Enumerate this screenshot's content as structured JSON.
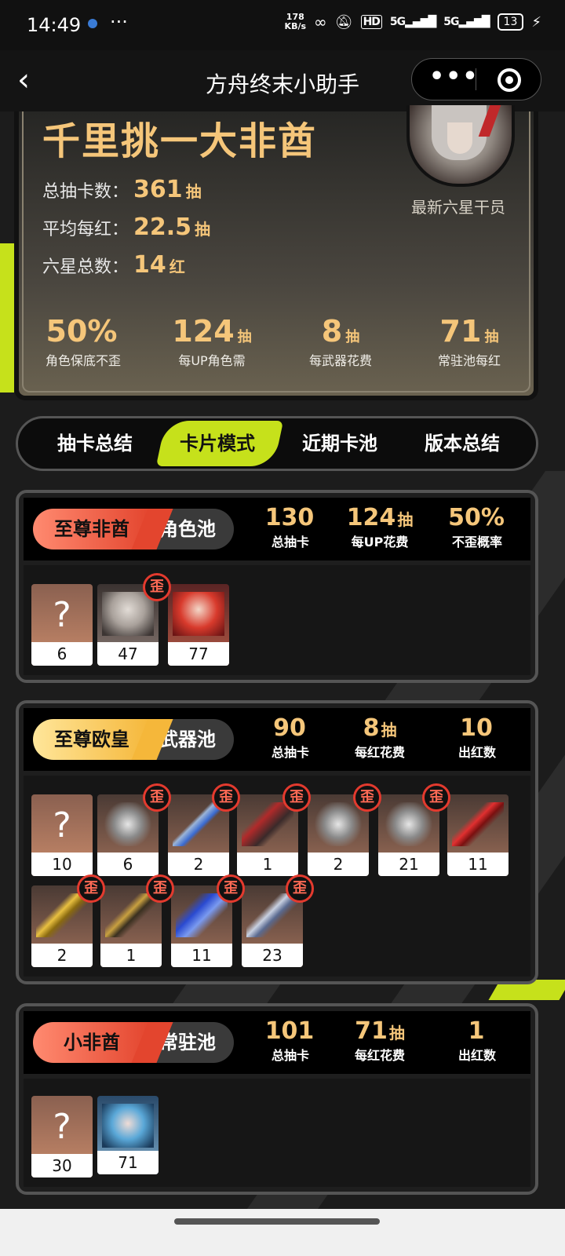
{
  "status": {
    "time": "14:49",
    "speed": "178",
    "speed_unit": "KB/s",
    "battery": "13",
    "net1": "5G",
    "net2": "5G",
    "hd": "HD"
  },
  "nav": {
    "title": "方舟终末小助手"
  },
  "summary": {
    "title": "千里挑一大非酋",
    "lines": [
      {
        "label": "总抽卡数：",
        "value": "361",
        "unit": "抽"
      },
      {
        "label": "平均每红：",
        "value": "22.5",
        "unit": "抽"
      },
      {
        "label": "六星总数：",
        "value": "14",
        "unit": "红"
      }
    ],
    "latest_label": "最新六星干员",
    "mini": [
      {
        "num": "50%",
        "unit": "",
        "label": "角色保底不歪"
      },
      {
        "num": "124",
        "unit": "抽",
        "label": "每UP角色需"
      },
      {
        "num": "8",
        "unit": "抽",
        "label": "每武器花费"
      },
      {
        "num": "71",
        "unit": "抽",
        "label": "常驻池每红"
      }
    ]
  },
  "tabs": [
    "抽卡总结",
    "卡片模式",
    "近期卡池",
    "版本总结"
  ],
  "wai_label": "歪",
  "unknown_mark": "?",
  "pools": [
    {
      "badge": "至尊非酋",
      "name": "角色池",
      "stats": [
        {
          "n": "130",
          "u": "",
          "l": "总抽卡"
        },
        {
          "n": "124",
          "u": "抽",
          "l": "每UP花费"
        },
        {
          "n": "50%",
          "u": "",
          "l": "不歪概率"
        }
      ],
      "items": [
        "6",
        "47",
        "77"
      ]
    },
    {
      "badge": "至尊欧皇",
      "name": "武器池",
      "stats": [
        {
          "n": "90",
          "u": "",
          "l": "总抽卡"
        },
        {
          "n": "8",
          "u": "抽",
          "l": "每红花费"
        },
        {
          "n": "10",
          "u": "",
          "l": "出红数"
        }
      ],
      "items": [
        "10",
        "6",
        "2",
        "1",
        "2",
        "21",
        "11",
        "2",
        "1",
        "11",
        "23"
      ]
    },
    {
      "badge": "小非酋",
      "name": "常驻池",
      "stats": [
        {
          "n": "101",
          "u": "",
          "l": "总抽卡"
        },
        {
          "n": "71",
          "u": "抽",
          "l": "每红花费"
        },
        {
          "n": "1",
          "u": "",
          "l": "出红数"
        }
      ],
      "items": [
        "30",
        "71"
      ]
    }
  ],
  "colors": {
    "accent": "#c6e11b",
    "gold": "#f5c67a",
    "wai_ring": "#e33a2e"
  }
}
